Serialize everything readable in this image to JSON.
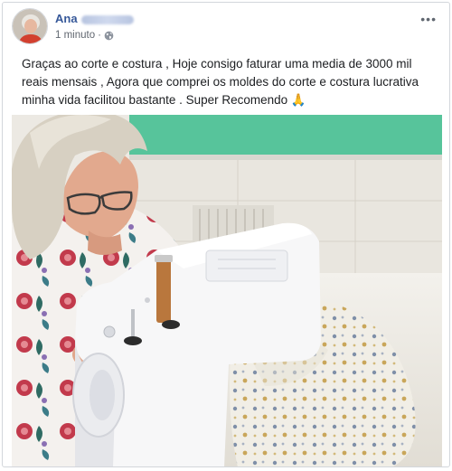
{
  "post": {
    "author_name": "Ana",
    "time": "1 minuto",
    "separator": "·",
    "privacy_icon": "globe-icon",
    "more_icon": "more-options-icon",
    "more_glyph": "•••",
    "text": "Graças ao corte e costura , Hoje consigo faturar uma media de 3000 mil reais mensais , Agora que comprei os moldes do corte e costura lucrativa minha vida facilitou bastante . Super Recomendo 🙏"
  },
  "colors": {
    "author_link": "#365899",
    "meta": "#616770",
    "wall_green": "#57c49b"
  }
}
